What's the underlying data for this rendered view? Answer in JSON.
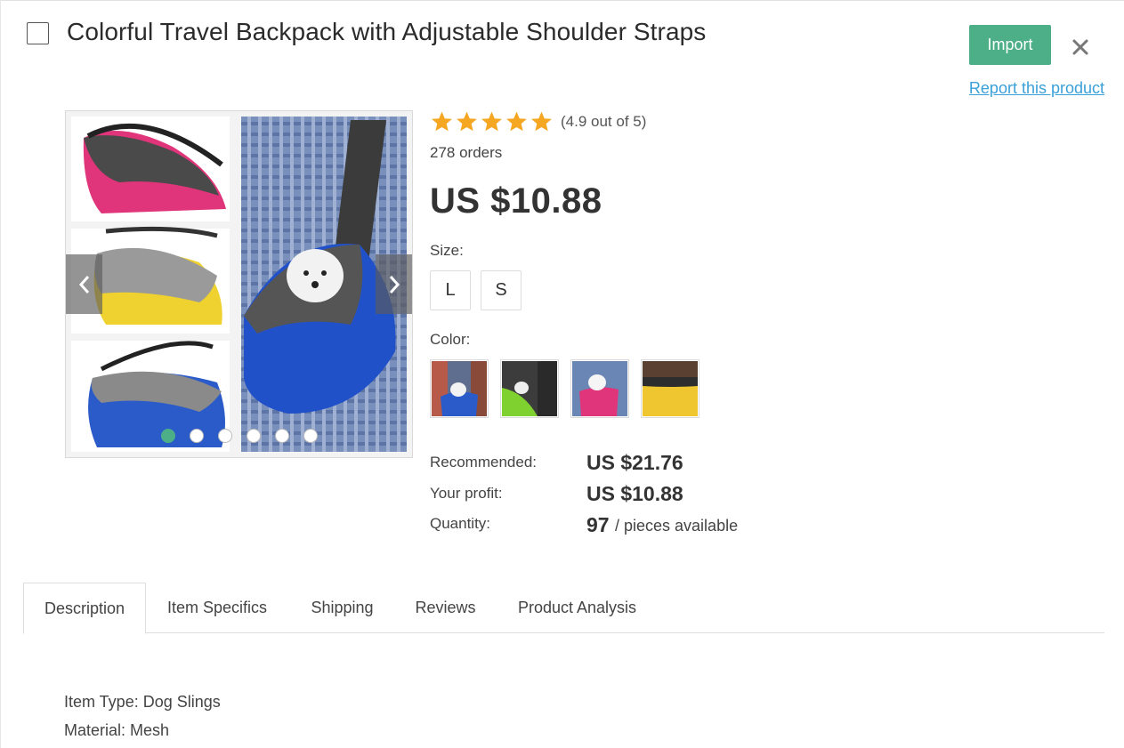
{
  "header": {
    "title": "Colorful Travel Backpack with Adjustable Shoulder Straps",
    "import_label": "Import",
    "close_symbol": "✕",
    "report_label": "Report this product"
  },
  "product": {
    "rating_text": "(4.9 out of 5)",
    "rating_value": 4.9,
    "rating_max": 5,
    "orders": "278 orders",
    "price": "US $10.88",
    "size_label": "Size:",
    "sizes": [
      "L",
      "S"
    ],
    "color_label": "Color:",
    "color_swatches": [
      "blue",
      "green",
      "pink",
      "yellow"
    ],
    "recommended_label": "Recommended:",
    "recommended_value": "US $21.76",
    "profit_label": "Your profit:",
    "profit_value": "US $10.88",
    "quantity_label": "Quantity:",
    "quantity_value": "97",
    "quantity_suffix": "/ pieces available"
  },
  "gallery": {
    "slide_count": 6,
    "active_slide": 1,
    "prev_icon": "chevron-left-icon",
    "next_icon": "chevron-right-icon"
  },
  "tabs": [
    {
      "label": "Description",
      "active": true
    },
    {
      "label": "Item Specifics",
      "active": false
    },
    {
      "label": "Shipping",
      "active": false
    },
    {
      "label": "Reviews",
      "active": false
    },
    {
      "label": "Product Analysis",
      "active": false
    }
  ],
  "description": {
    "lines": [
      "Item Type: Dog Slings",
      "Material: Mesh"
    ]
  },
  "colors": {
    "accent": "#4caf88",
    "link": "#3aa0d8",
    "star": "#f5a623"
  }
}
